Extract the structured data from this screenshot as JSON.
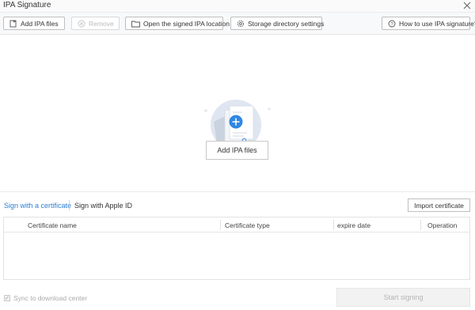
{
  "window": {
    "title": "IPA Signature"
  },
  "toolbar": {
    "add_ipa_files": "Add IPA files",
    "remove": "Remove",
    "open_signed_location": "Open the signed IPA location",
    "storage_settings": "Storage directory settings",
    "how_to_use": "How to use IPA signature?"
  },
  "drop_area": {
    "add_button": "Add IPA files"
  },
  "tabs": {
    "certificate": "Sign with a certificate",
    "apple_id": "Sign with Apple ID"
  },
  "import_certificate": "Import certificate",
  "table": {
    "headers": [
      "Certificate name",
      "Certificate type",
      "expire date",
      "Operation"
    ]
  },
  "footer": {
    "sync_label": "Sync to download center",
    "sync_checked": true,
    "start_button": "Start signing"
  },
  "colors": {
    "accent": "#2b7fd3",
    "plus_circle": "#2f86e5",
    "illustration_bg": "#dfe6f1"
  }
}
